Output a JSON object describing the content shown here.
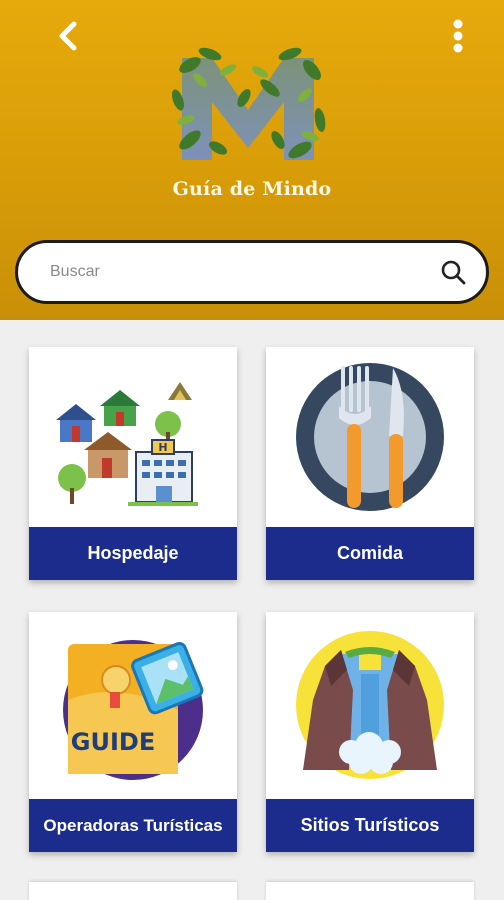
{
  "header": {
    "title": "Guía de Mindo",
    "back_icon": "chevron-left-icon",
    "menu_icon": "more-vertical-icon",
    "background": "#d99d09"
  },
  "search": {
    "placeholder": "Buscar",
    "value": "",
    "icon": "search-icon"
  },
  "categories": [
    {
      "label": "Hospedaje",
      "icon": "lodging-icon"
    },
    {
      "label": "Comida",
      "icon": "food-plate-icon"
    },
    {
      "label": "Operadoras Turísticas",
      "icon": "tour-guide-icon"
    },
    {
      "label": "Sitios Turísticos",
      "icon": "waterfall-icon"
    }
  ],
  "colors": {
    "accent": "#1c2c8c",
    "header": "#d99d09"
  }
}
